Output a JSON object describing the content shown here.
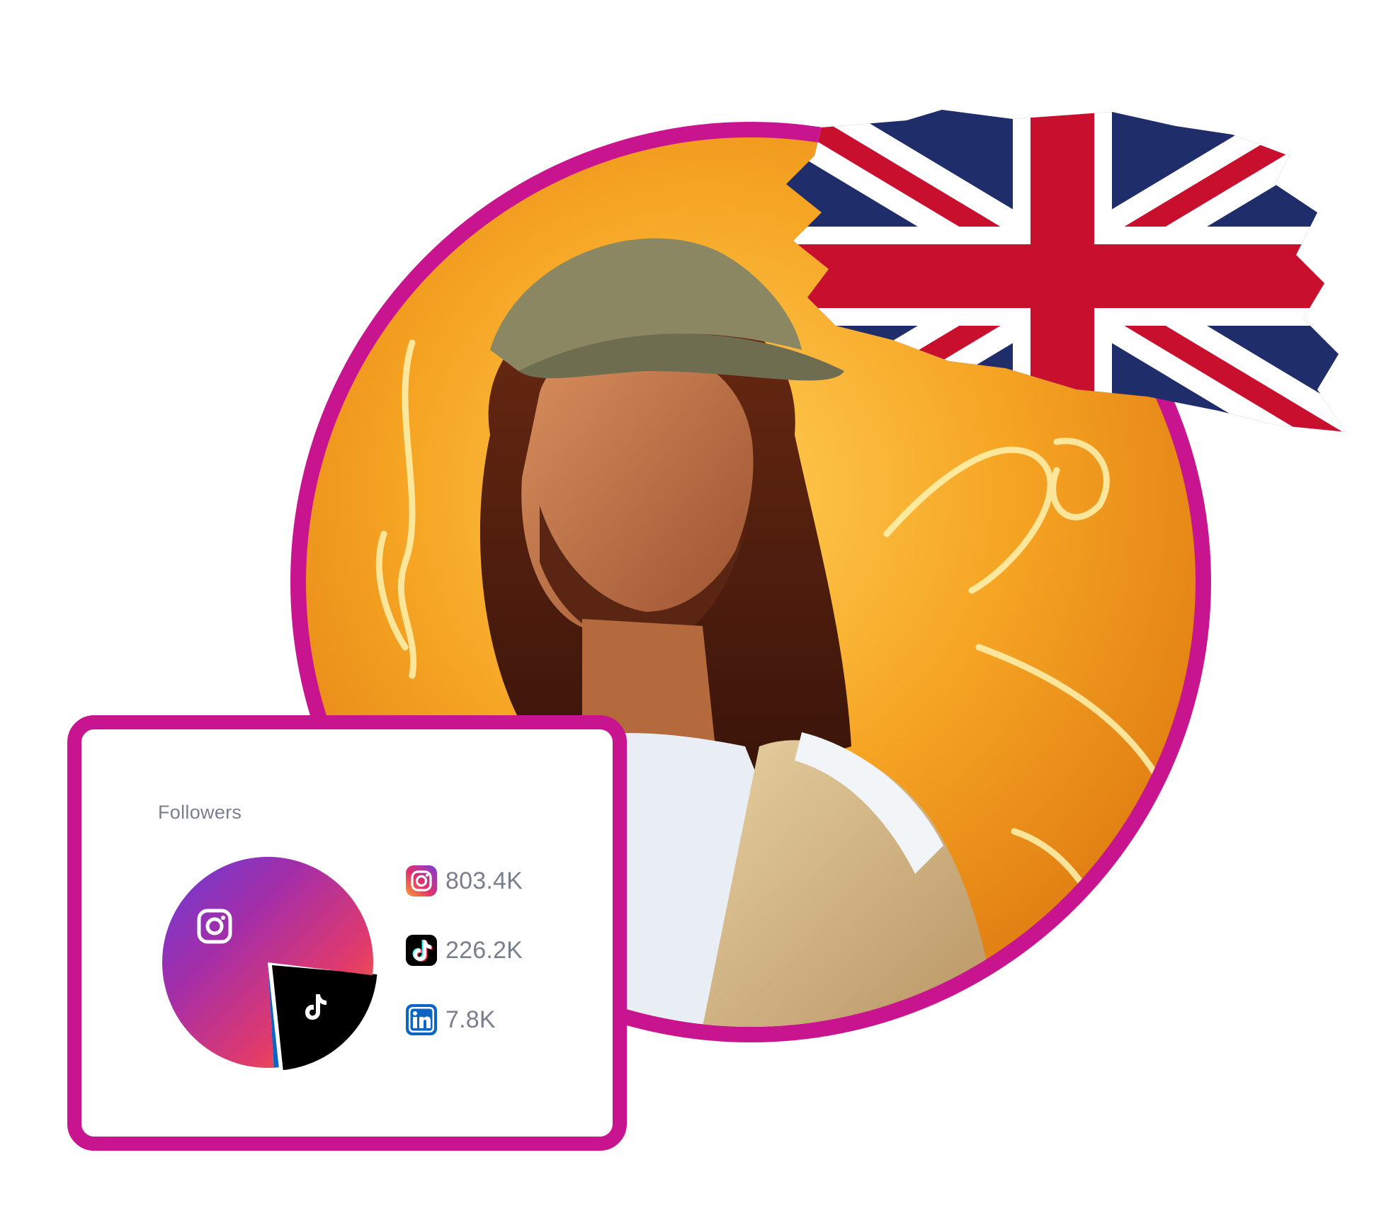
{
  "followers_card": {
    "title": "Followers",
    "colors": {
      "border": "#c8148f",
      "text": "#7a7f8e"
    },
    "platforms": [
      {
        "name": "instagram",
        "icon": "instagram-icon",
        "value": "803.4K",
        "share": 0.7787
      },
      {
        "name": "tiktok",
        "icon": "tiktok-icon",
        "value": "226.2K",
        "share": 0.2193
      },
      {
        "name": "linkedin",
        "icon": "linkedin-icon",
        "value": "7.8K",
        "share": 0.0076
      }
    ]
  },
  "avatar": {
    "ring_color": "#c8148f",
    "background_color": "#f0a020"
  },
  "flag": {
    "icon": "union-jack-flag-icon",
    "colors": {
      "blue": "#1f2d6b",
      "red": "#c8102e",
      "white": "#ffffff"
    }
  }
}
